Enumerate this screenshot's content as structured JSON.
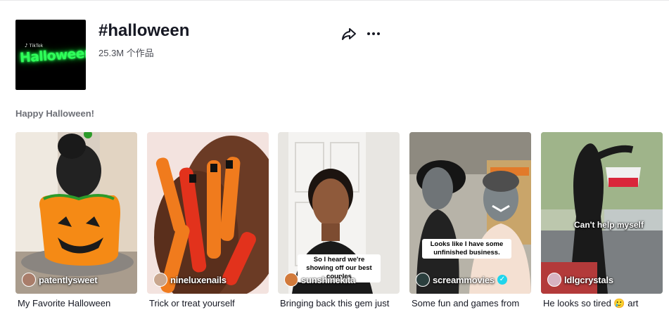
{
  "header": {
    "title": "#halloween",
    "video_count": "25.3M 个作品",
    "avatar_brand": "TikTok",
    "avatar_logo_text": "Halloween",
    "share_icon": "share-arrow-icon",
    "more_icon": "more-dots-icon"
  },
  "description": "Happy Halloween!",
  "videos": [
    {
      "author": "patentlysweet",
      "caption": "My Favorite Halloween",
      "verified": false,
      "overlay_text": ""
    },
    {
      "author": "nineluxenails",
      "caption": "Trick or treat yourself",
      "verified": false,
      "overlay_text": ""
    },
    {
      "author": "sunshinekita",
      "caption": "Bringing back this gem just",
      "verified": false,
      "overlay_text": "So I heard we're showing off our best couples"
    },
    {
      "author": "screammovies",
      "caption": "Some fun and games from",
      "verified": true,
      "overlay_text": "Looks like I have some unfinished business."
    },
    {
      "author": "ldlgcrystals",
      "caption": "He looks so tired 🥲 art",
      "verified": false,
      "overlay_text": "Can't help myself"
    }
  ],
  "colors": {
    "accent_verified": "#20d5ec",
    "neon_green": "#2fff5a"
  }
}
